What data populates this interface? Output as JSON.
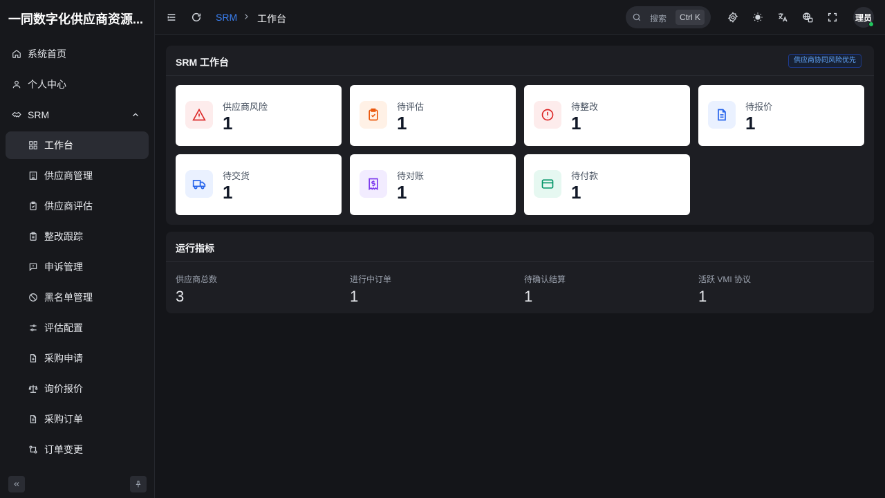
{
  "app": {
    "title": "一同数字化供应商资源..."
  },
  "sidebar": {
    "items": [
      {
        "label": "系统首页",
        "icon": "home-icon"
      },
      {
        "label": "个人中心",
        "icon": "user-icon"
      },
      {
        "label": "SRM",
        "icon": "handshake-icon",
        "expanded": true
      }
    ],
    "subitems": [
      {
        "label": "工作台",
        "icon": "dashboard-icon",
        "active": true
      },
      {
        "label": "供应商管理",
        "icon": "building-icon"
      },
      {
        "label": "供应商评估",
        "icon": "clipboard-check-icon"
      },
      {
        "label": "整改跟踪",
        "icon": "clipboard-list-icon"
      },
      {
        "label": "申诉管理",
        "icon": "message-alert-icon"
      },
      {
        "label": "黑名单管理",
        "icon": "ban-icon"
      },
      {
        "label": "评估配置",
        "icon": "sliders-icon"
      },
      {
        "label": "采购申请",
        "icon": "file-plus-icon"
      },
      {
        "label": "询价报价",
        "icon": "scale-icon"
      },
      {
        "label": "采购订单",
        "icon": "file-text-icon"
      },
      {
        "label": "订单变更",
        "icon": "git-compare-icon"
      }
    ]
  },
  "header": {
    "breadcrumb": {
      "parent": "SRM",
      "current": "工作台"
    },
    "search": {
      "placeholder": "搜索",
      "shortcut": "Ctrl K"
    },
    "avatar_text": "理员"
  },
  "workbench": {
    "title": "SRM 工作台",
    "tag": "供应商协同风险优先",
    "cards": [
      {
        "label": "供应商风险",
        "value": "1",
        "icon": "alert-triangle-icon",
        "color": "#dc2626",
        "bg": "#fdecec"
      },
      {
        "label": "待评估",
        "value": "1",
        "icon": "clipboard-check-icon",
        "color": "#ea580c",
        "bg": "#fff1e6"
      },
      {
        "label": "待整改",
        "value": "1",
        "icon": "alert-circle-icon",
        "color": "#dc2626",
        "bg": "#fdecec"
      },
      {
        "label": "待报价",
        "value": "1",
        "icon": "file-text-icon",
        "color": "#2563eb",
        "bg": "#eaf1ff"
      },
      {
        "label": "待交货",
        "value": "1",
        "icon": "truck-icon",
        "color": "#2563eb",
        "bg": "#eaf1ff"
      },
      {
        "label": "待对账",
        "value": "1",
        "icon": "receipt-icon",
        "color": "#7c3aed",
        "bg": "#f2ecff"
      },
      {
        "label": "待付款",
        "value": "1",
        "icon": "credit-card-icon",
        "color": "#059669",
        "bg": "#e6f8f1"
      }
    ]
  },
  "metrics": {
    "title": "运行指标",
    "items": [
      {
        "label": "供应商总数",
        "value": "3"
      },
      {
        "label": "进行中订单",
        "value": "1"
      },
      {
        "label": "待确认结算",
        "value": "1"
      },
      {
        "label": "活跃 VMI 协议",
        "value": "1"
      }
    ]
  },
  "colors": {
    "accent": "#3b82f6",
    "online": "#22c55e"
  }
}
